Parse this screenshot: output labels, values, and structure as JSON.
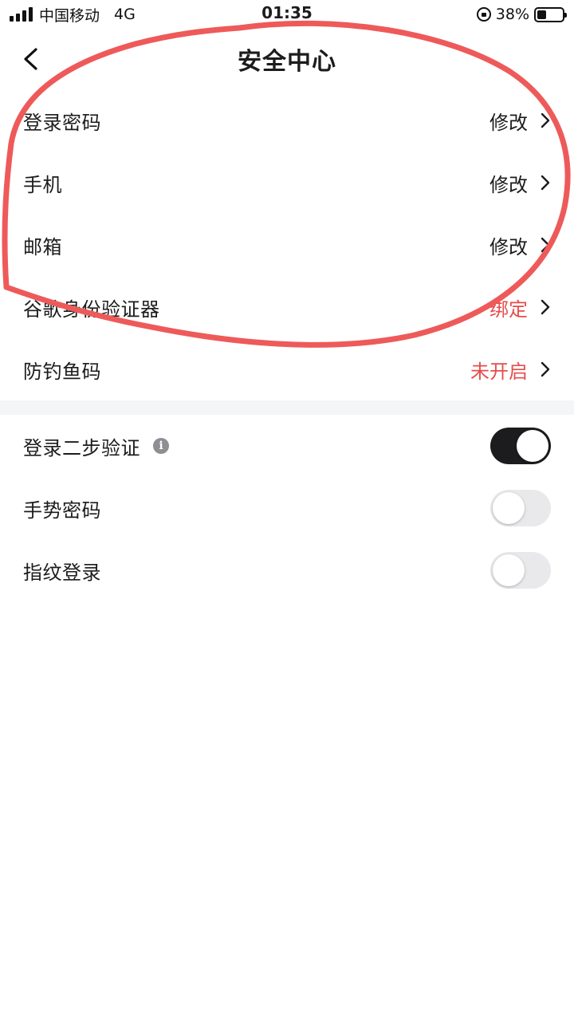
{
  "status_bar": {
    "carrier": "中国移动",
    "network": "4G",
    "time": "01:35",
    "battery_percent": "38%",
    "battery_level": 0.38
  },
  "nav": {
    "back_icon": "chevron-left-icon",
    "title": "安全中心"
  },
  "security_items": [
    {
      "label": "登录密码",
      "value": "修改",
      "value_color": "#1c1c1e"
    },
    {
      "label": "手机",
      "value": "修改",
      "value_color": "#1c1c1e"
    },
    {
      "label": "邮箱",
      "value": "修改",
      "value_color": "#1c1c1e"
    },
    {
      "label": "谷歌身份验证器",
      "value": "绑定",
      "value_color": "#e54d4d"
    },
    {
      "label": "防钓鱼码",
      "value": "未开启",
      "value_color": "#e54d4d"
    }
  ],
  "toggles": [
    {
      "label": "登录二步验证",
      "has_info": true,
      "on": true
    },
    {
      "label": "手势密码",
      "has_info": false,
      "on": false
    },
    {
      "label": "指纹登录",
      "has_info": false,
      "on": false
    }
  ],
  "colors": {
    "accent_dark": "#1c1c1e",
    "alert_red": "#e54d4d",
    "annotation_red": "#ee5a5a",
    "divider": "#f4f5f7"
  }
}
